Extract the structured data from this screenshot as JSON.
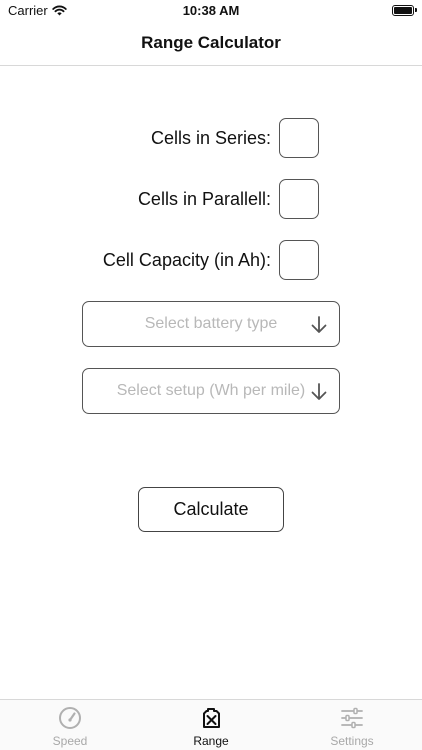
{
  "status_bar": {
    "carrier": "Carrier",
    "time": "10:38 AM"
  },
  "nav": {
    "title": "Range Calculator"
  },
  "form": {
    "cells_series_label": "Cells in Series:",
    "cells_parallel_label": "Cells in Parallell:",
    "cell_capacity_label": "Cell Capacity (in Ah):",
    "cells_series_value": "",
    "cells_parallel_value": "",
    "cell_capacity_value": ""
  },
  "selects": {
    "battery_type_placeholder": "Select battery type",
    "setup_placeholder": "Select setup (Wh per mile)"
  },
  "actions": {
    "calculate_label": "Calculate"
  },
  "tabs": [
    {
      "label": "Speed",
      "icon": "speedometer-icon",
      "active": false
    },
    {
      "label": "Range",
      "icon": "fuel-can-icon",
      "active": true
    },
    {
      "label": "Settings",
      "icon": "sliders-icon",
      "active": false
    }
  ],
  "colors": {
    "active_tab": "#111111",
    "inactive_tab": "#a8a8a8",
    "placeholder": "#b8b8b8",
    "border": "#555555"
  }
}
